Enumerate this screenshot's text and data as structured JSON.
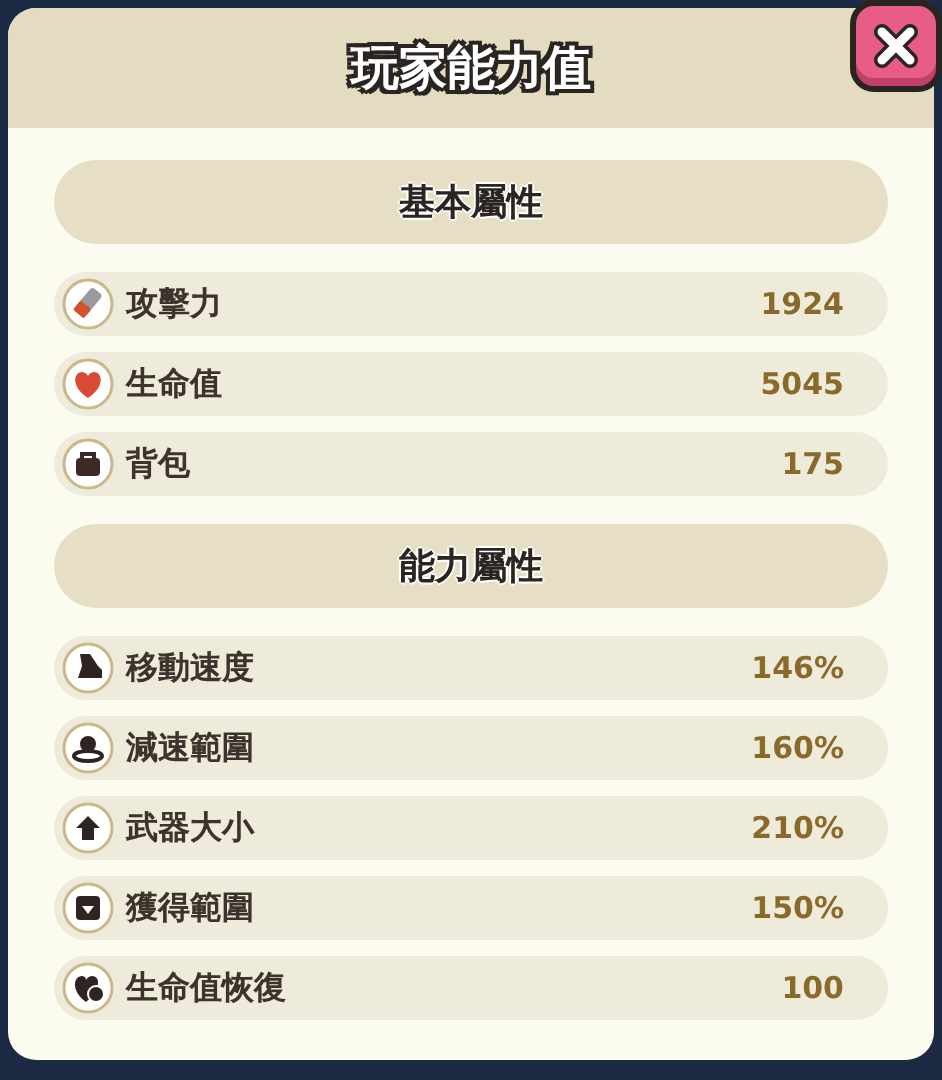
{
  "title": "玩家能力值",
  "sections": [
    {
      "heading": "基本屬性",
      "stats": [
        {
          "kind": "attack",
          "label": "攻擊力",
          "value": "1924"
        },
        {
          "kind": "health",
          "label": "生命值",
          "value": "5045"
        },
        {
          "kind": "bag",
          "label": "背包",
          "value": "175"
        }
      ]
    },
    {
      "heading": "能力屬性",
      "stats": [
        {
          "kind": "speed",
          "label": "移動速度",
          "value": "146%"
        },
        {
          "kind": "slow",
          "label": "減速範圍",
          "value": "160%"
        },
        {
          "kind": "weapon",
          "label": "武器大小",
          "value": "210%"
        },
        {
          "kind": "pickup",
          "label": "獲得範圍",
          "value": "150%"
        },
        {
          "kind": "regen",
          "label": "生命值恢復",
          "value": "100"
        }
      ]
    }
  ]
}
